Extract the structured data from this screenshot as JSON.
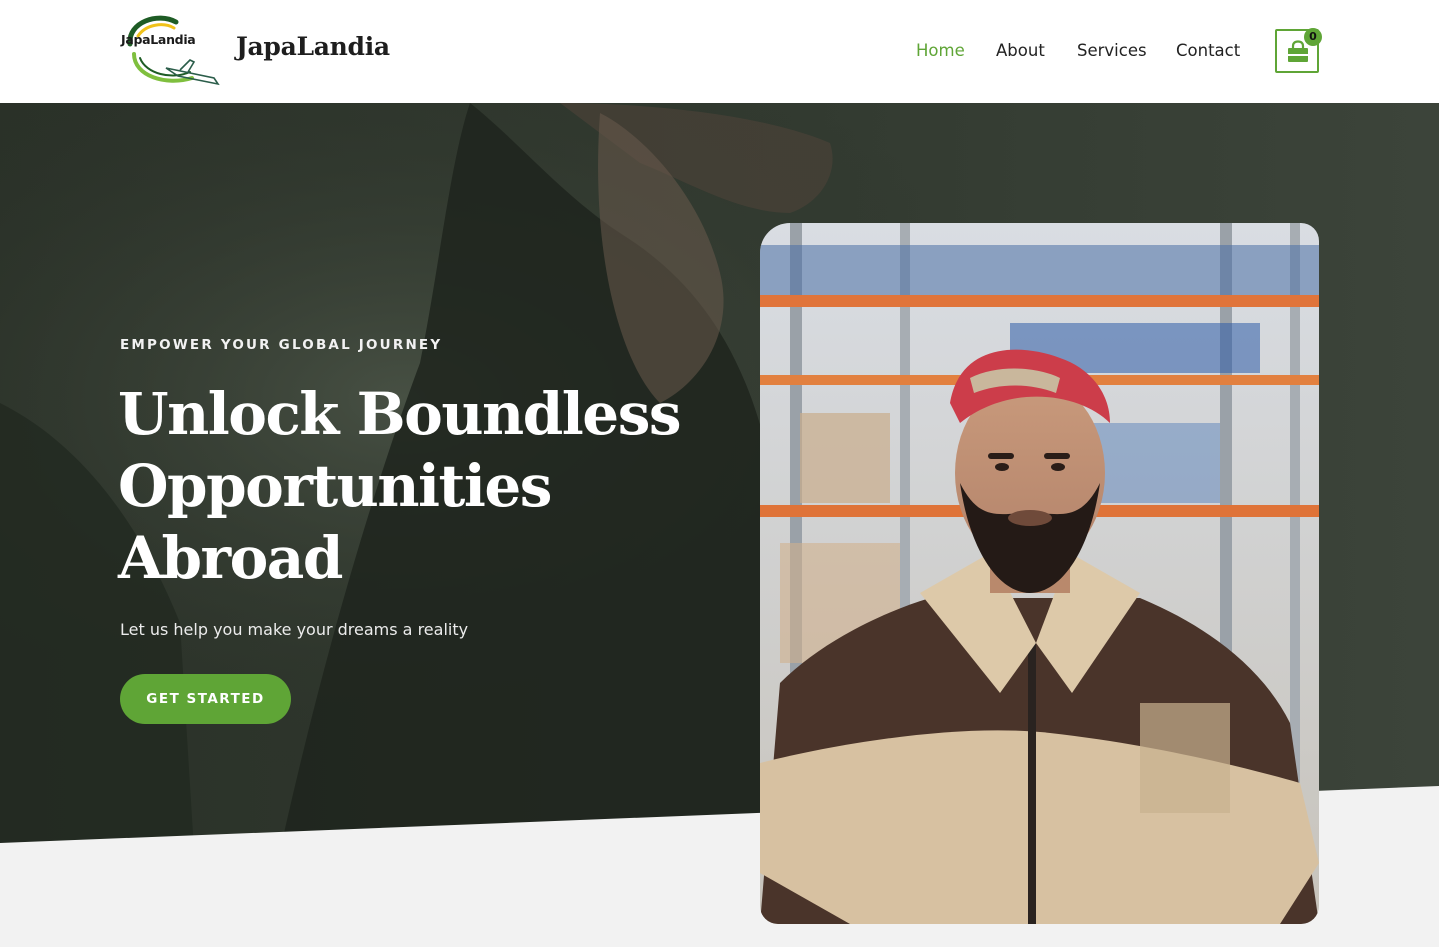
{
  "header": {
    "logo_text": "JapaLandia",
    "brand_name": "JapaLandia",
    "nav": [
      {
        "label": "Home",
        "active": true
      },
      {
        "label": "About",
        "active": false
      },
      {
        "label": "Services",
        "active": false
      },
      {
        "label": "Contact",
        "active": false
      }
    ],
    "cart": {
      "icon": "shopping-bag-icon",
      "count": "0"
    }
  },
  "hero": {
    "eyebrow": "EMPOWER YOUR GLOBAL JOURNEY",
    "headline_lines": [
      "Unlock Boundless",
      "Opportunities",
      "Abroad"
    ],
    "subtext": "Let us help you make your dreams a reality",
    "cta_label": "GET STARTED",
    "background_image": "woman-on-phone-photo",
    "feature_image": "warehouse-worker-photo"
  },
  "colors": {
    "accent": "#5fa536",
    "overlay": "#2b3229",
    "page_bg": "#f2f2f2"
  }
}
